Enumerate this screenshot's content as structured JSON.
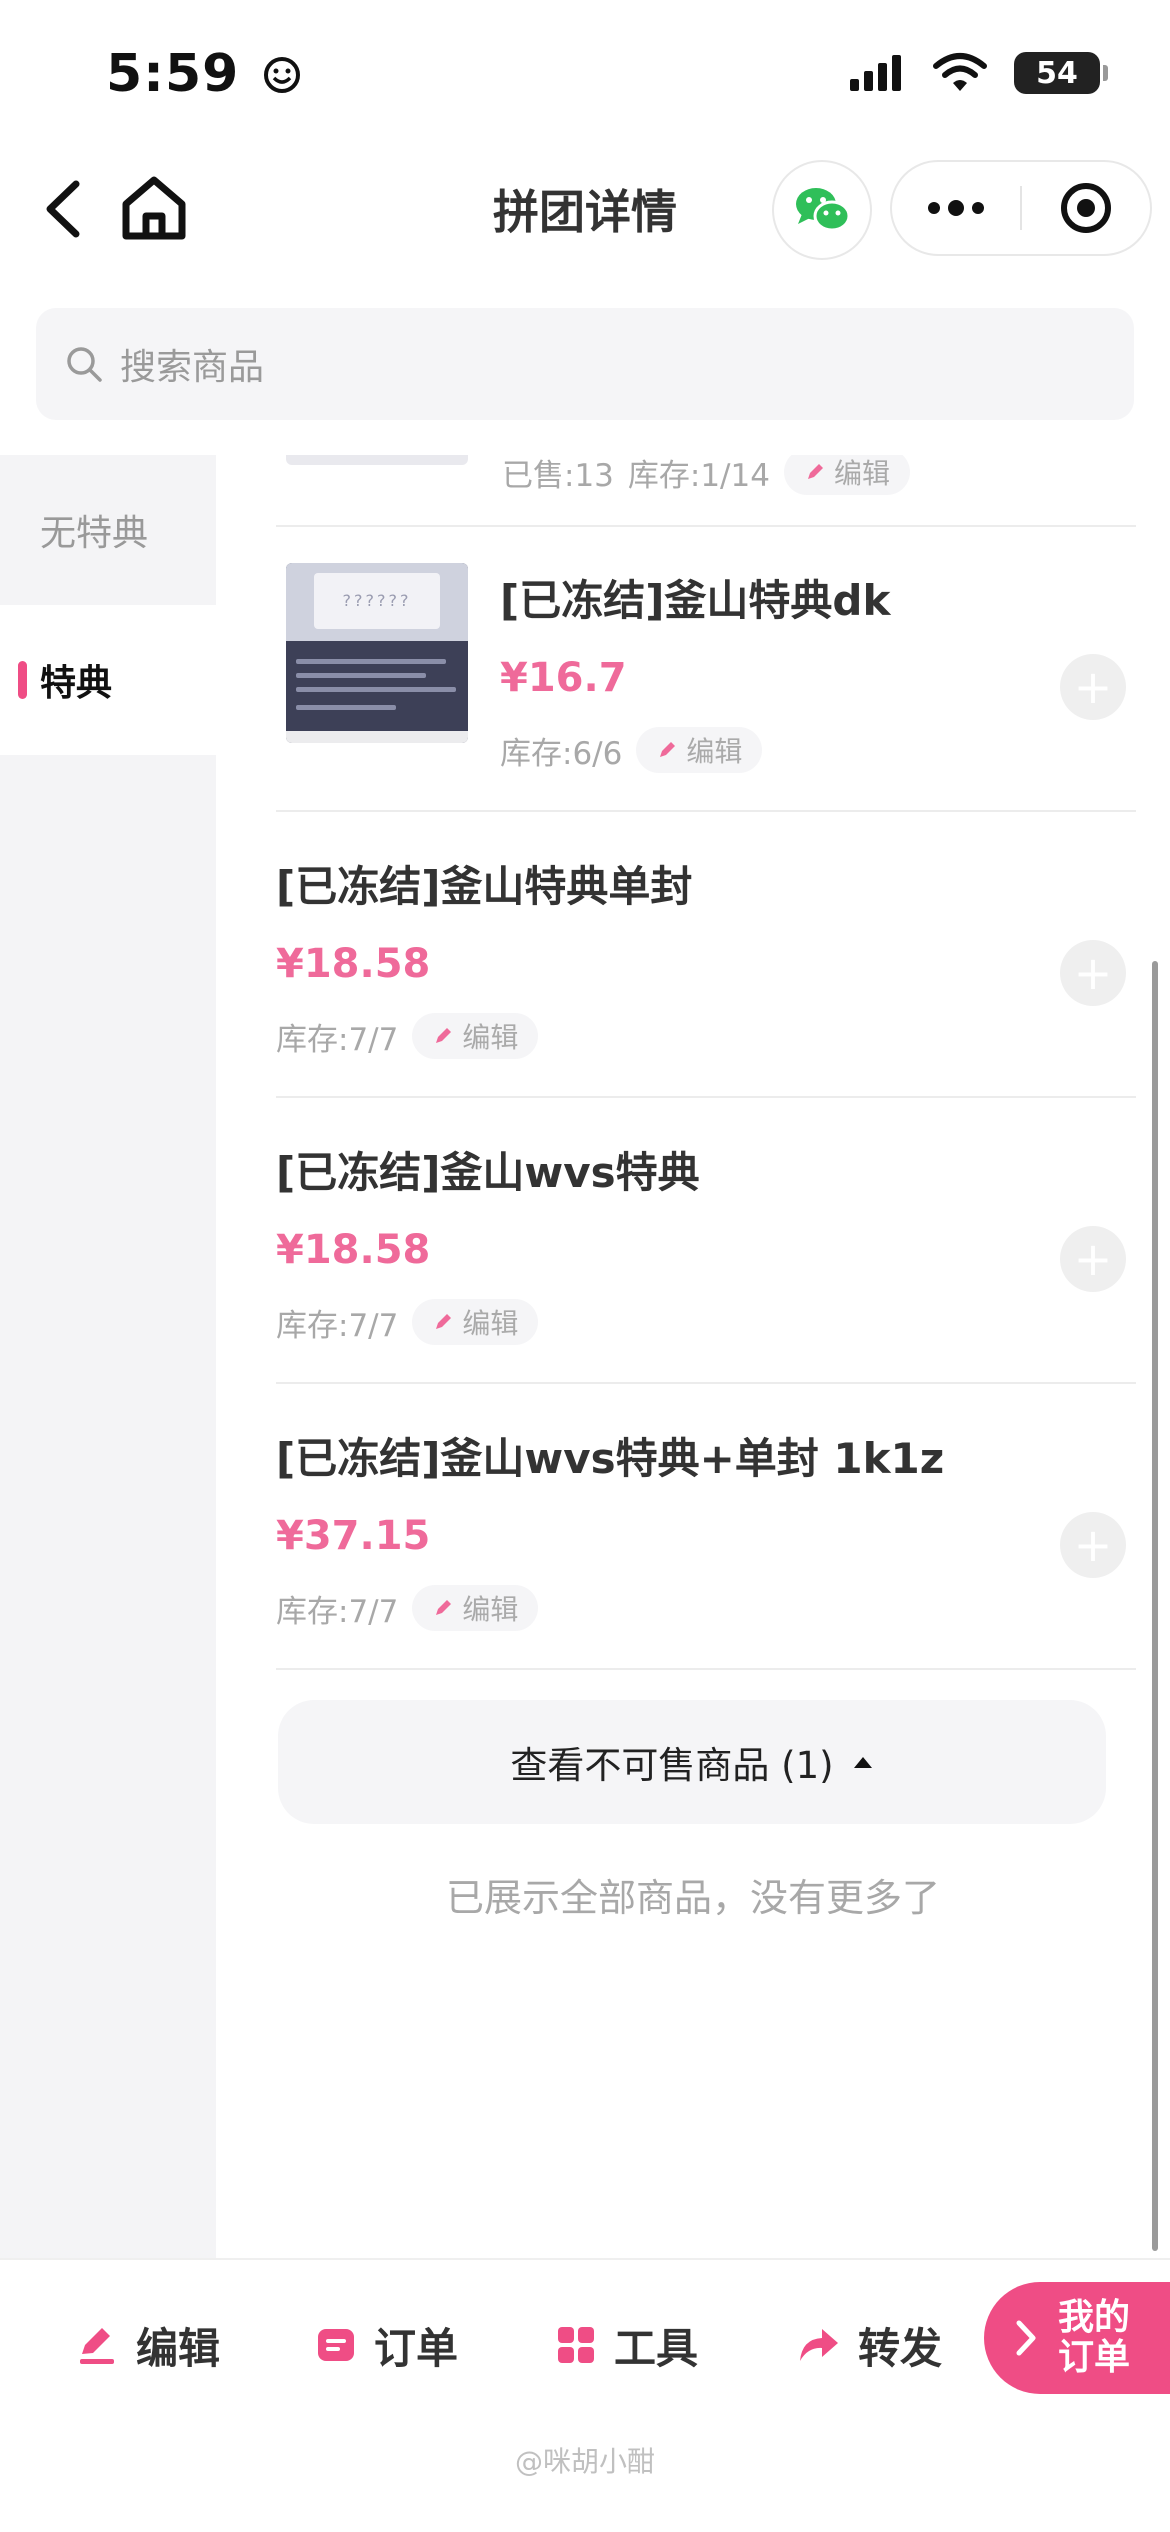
{
  "status_bar": {
    "time": "5:59",
    "battery": "54"
  },
  "nav": {
    "title": "拼团详情"
  },
  "search": {
    "placeholder": "搜索商品"
  },
  "sidebar": {
    "items": [
      {
        "label": "无特典",
        "active": false
      },
      {
        "label": "特典",
        "active": true
      }
    ]
  },
  "list": {
    "partial_item": {
      "sold": "已售:13",
      "stock": "库存:1/14",
      "edit": "编辑"
    },
    "thumbnail_text": "??????",
    "products": [
      {
        "title": "[已冻结]釜山特典dk",
        "price": "¥16.7",
        "stock": "库存:6/6",
        "edit": "编辑",
        "has_image": true
      },
      {
        "title": "[已冻结]釜山特典单封",
        "price": "¥18.58",
        "stock": "库存:7/7",
        "edit": "编辑",
        "has_image": false
      },
      {
        "title": "[已冻结]釜山wvs特典",
        "price": "¥18.58",
        "stock": "库存:7/7",
        "edit": "编辑",
        "has_image": false
      },
      {
        "title": "[已冻结]釜山wvs特典+单封 1k1z",
        "price": "¥37.15",
        "stock": "库存:7/7",
        "edit": "编辑",
        "has_image": false
      }
    ],
    "unsellable_label": "查看不可售商品 (1)",
    "end_text": "已展示全部商品，没有更多了"
  },
  "bottom_bar": {
    "edit": "编辑",
    "orders": "订单",
    "tools": "工具",
    "forward": "转发",
    "my_orders": "我的订单"
  },
  "watermark": "@咪胡小酣",
  "colors": {
    "accent": "#ef4d85",
    "price": "#ef6a9a"
  }
}
